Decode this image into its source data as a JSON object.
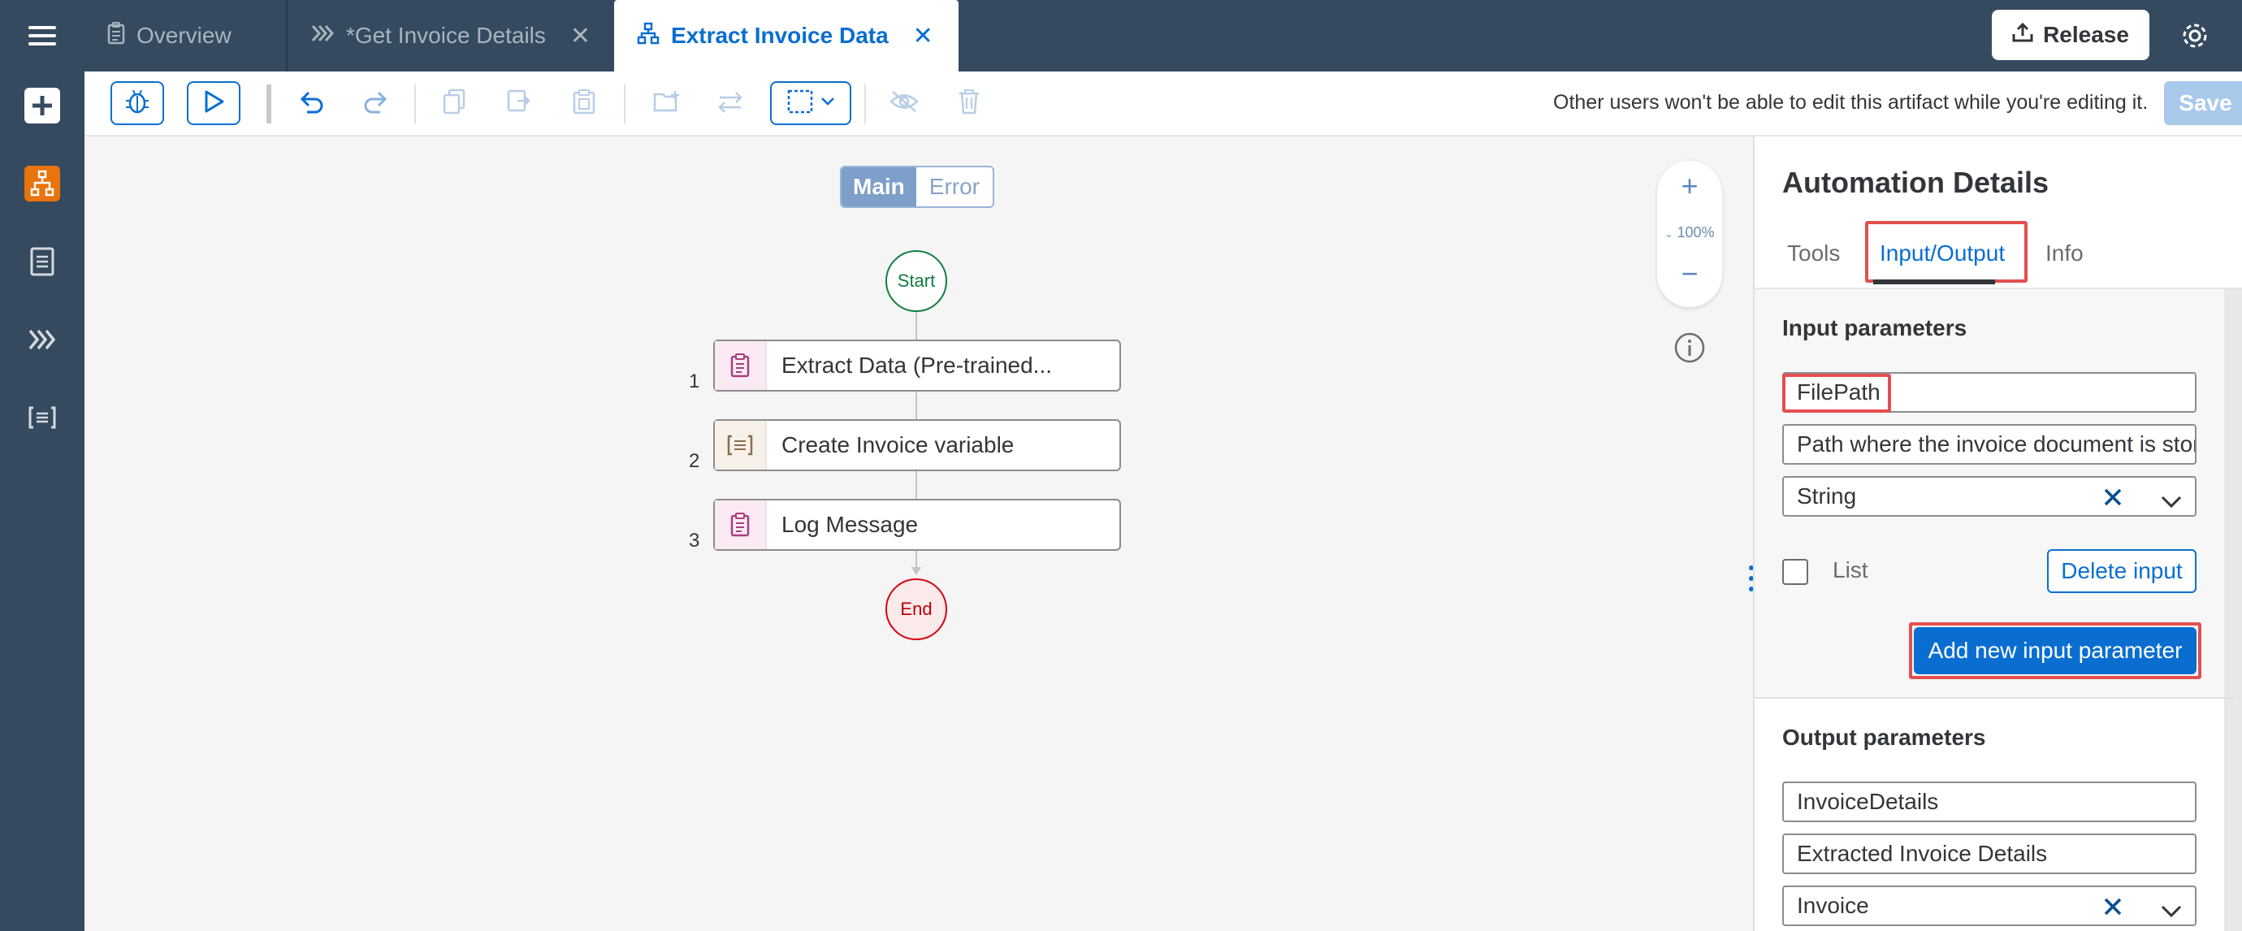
{
  "tabs": [
    {
      "label": "Overview",
      "icon": "document-icon",
      "active": false
    },
    {
      "label": "*Get Invoice Details",
      "icon": "process-chevrons-icon",
      "active": false,
      "closable": true
    },
    {
      "label": "Extract Invoice Data",
      "icon": "automation-hierarchy-icon",
      "active": true,
      "closable": true
    }
  ],
  "shell": {
    "release_label": "Release"
  },
  "toolbar": {
    "lock_message": "Other users won't be able to edit this artifact while you're editing it.",
    "save_label": "Save"
  },
  "canvas": {
    "segment": {
      "main": "Main",
      "error": "Error"
    },
    "start_label": "Start",
    "end_label": "End",
    "steps": [
      {
        "num": "1",
        "label": "Extract Data (Pre-trained...",
        "icon": "clipboard-icon"
      },
      {
        "num": "2",
        "label": "Create Invoice variable",
        "icon": "variable-list-icon"
      },
      {
        "num": "3",
        "label": "Log Message",
        "icon": "clipboard-icon"
      }
    ],
    "zoom": {
      "plus": "+",
      "level": "100%",
      "minus": "−"
    }
  },
  "panel": {
    "title": "Automation Details",
    "tabs": [
      "Tools",
      "Input/Output",
      "Info"
    ],
    "active_tab": "Input/Output",
    "input": {
      "title": "Input parameters",
      "name": "FilePath",
      "description": "Path where the invoice document is stored",
      "type": "String",
      "list_label": "List",
      "delete_label": "Delete input",
      "add_label": "Add new input parameter"
    },
    "output": {
      "title": "Output parameters",
      "name": "InvoiceDetails",
      "description": "Extracted Invoice Details",
      "type": "Invoice"
    }
  },
  "colors": {
    "shell": "#354a5f",
    "accent": "#0a6ed1",
    "highlight": "#e34f4f",
    "start": "#107e3e",
    "end": "#d5000e"
  }
}
